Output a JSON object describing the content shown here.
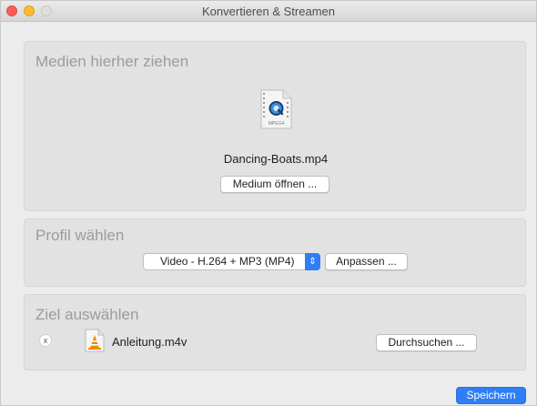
{
  "window": {
    "title": "Konvertieren & Streamen"
  },
  "media": {
    "heading": "Medien hierher ziehen",
    "file_type_badge": "MPEG4",
    "file_name": "Dancing-Boats.mp4",
    "open_button": "Medium öffnen ...",
    "file_icon": "quicktime-file-icon"
  },
  "profile": {
    "heading": "Profil wählen",
    "selected": "Video - H.264 + MP3 (MP4)",
    "customize_button": "Anpassen ..."
  },
  "destination": {
    "heading": "Ziel auswählen",
    "remove_label": "x",
    "file_name": "Anleitung.m4v",
    "browse_button": "Durchsuchen ...",
    "file_icon": "vlc-file-icon"
  },
  "footer": {
    "save_button": "Speichern"
  },
  "colors": {
    "accent": "#2f7ef6",
    "window_bg": "#ececec",
    "panel_bg": "#e2e2e2",
    "heading_gray": "#9c9c9c"
  }
}
